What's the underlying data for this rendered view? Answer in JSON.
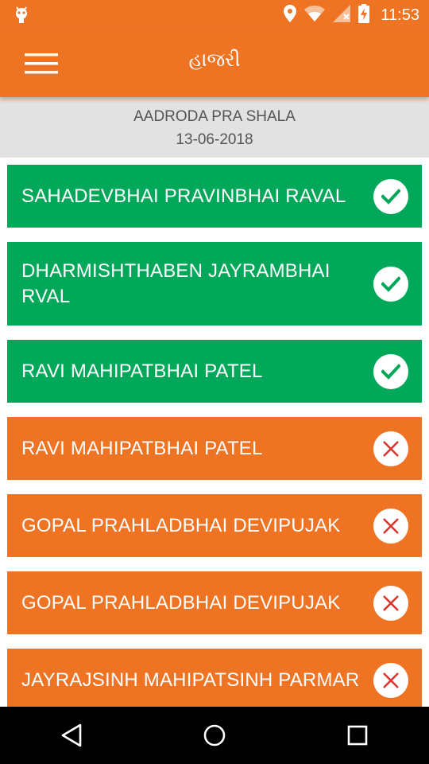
{
  "status_bar": {
    "time": "11:53",
    "icons": [
      "android-debug-icon",
      "location-icon",
      "wifi-icon",
      "no-sim-icon",
      "battery-charging-icon"
    ]
  },
  "app_bar": {
    "title": "હાજરી",
    "menu_icon": "hamburger-menu-icon"
  },
  "info": {
    "school": "AADRODA PRA SHALA",
    "date": "13-06-2018"
  },
  "students": [
    {
      "name": "SAHADEVBHAI PRAVINBHAI RAVAL",
      "status": "present"
    },
    {
      "name": "DHARMISHTHABEN JAYRAMBHAI RVAL",
      "status": "present"
    },
    {
      "name": "RAVI MAHIPATBHAI PATEL",
      "status": "present"
    },
    {
      "name": "RAVI MAHIPATBHAI PATEL",
      "status": "absent"
    },
    {
      "name": "GOPAL PRAHLADBHAI DEVIPUJAK",
      "status": "absent"
    },
    {
      "name": "GOPAL PRAHLADBHAI DEVIPUJAK",
      "status": "absent"
    },
    {
      "name": "JAYRAJSINH MAHIPATSINH PARMAR",
      "status": "absent"
    }
  ],
  "colors": {
    "primary": "#EE7424",
    "present": "#02A85A",
    "absent": "#EE7424",
    "info_bg": "#E2E2E2"
  },
  "nav": [
    "back-icon",
    "home-icon",
    "recents-icon"
  ]
}
